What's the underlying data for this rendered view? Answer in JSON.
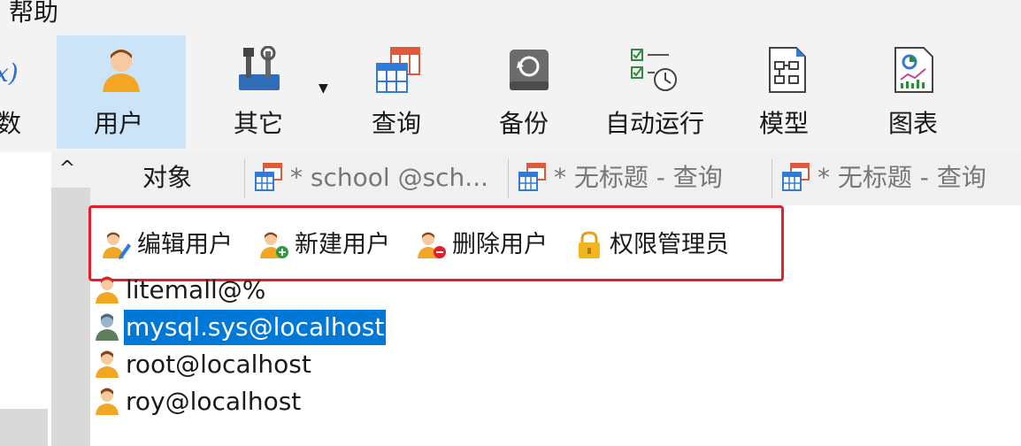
{
  "menu": {
    "help": "帮助"
  },
  "toolbar": {
    "partial_left": "数",
    "buttons": [
      {
        "label": "用户",
        "icon": "user-icon",
        "active": true
      },
      {
        "label": "其它",
        "icon": "tools-icon"
      },
      {
        "label": "查询",
        "icon": "query-icon"
      },
      {
        "label": "备份",
        "icon": "backup-icon"
      },
      {
        "label": "自动运行",
        "icon": "schedule-icon"
      },
      {
        "label": "模型",
        "icon": "model-icon"
      },
      {
        "label": "图表",
        "icon": "chart-icon"
      }
    ]
  },
  "tabs": [
    {
      "label": "对象"
    },
    {
      "label": "* school @sch...",
      "icon": "table-icon"
    },
    {
      "label": "* 无标题 - 查询",
      "icon": "table-icon"
    },
    {
      "label": "* 无标题 - 查询",
      "icon": "table-icon"
    }
  ],
  "object_toolbar": {
    "edit_user": "编辑用户",
    "new_user": "新建用户",
    "delete_user": "删除用户",
    "privilege_manager": "权限管理员"
  },
  "users": [
    {
      "name": "litemall@%",
      "selected": false
    },
    {
      "name": "mysql.sys@localhost",
      "selected": true
    },
    {
      "name": "root@localhost",
      "selected": false
    },
    {
      "name": "roy@localhost",
      "selected": false
    }
  ],
  "colors": {
    "selection": "#0078d7",
    "highlight_border": "#e0202a",
    "active_tab_bg": "#cce4f7"
  }
}
